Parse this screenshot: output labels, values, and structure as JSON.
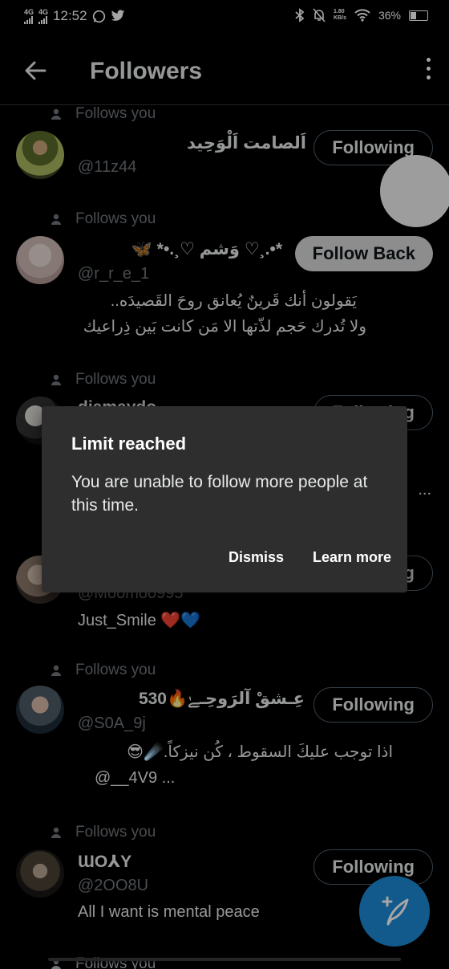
{
  "status_bar": {
    "net1": "4G",
    "net2": "4G",
    "time": "12:52",
    "speed_top": "1.80",
    "speed_bottom": "KB/s",
    "battery": "36%"
  },
  "header": {
    "title": "Followers"
  },
  "followers": [
    {
      "context": "Follows you",
      "name": "اَلصامت اَلْوَحِيد",
      "handle": "@11z44",
      "bio": [],
      "button": "Following"
    },
    {
      "context": "Follows you",
      "name": "🦋 *•.¸♡ وَشم ♡¸.•*",
      "handle": "@r_r_e_1",
      "bio": [
        "يَقولون أنك قَرينٌ يُعانق روحَ القَصيدَه..",
        "ولا تُدرك حَجم لذّتها الا مَن كانت بَين ذِراعيك"
      ],
      "button": "Follow Back"
    },
    {
      "context": "Follows you",
      "name": "djamaydo",
      "handle": "",
      "bio": [
        "..."
      ],
      "button": "Following"
    },
    {
      "context": "",
      "name": "",
      "handle": "@Moomoo995",
      "bio": [
        "Just_Smile ❤️💙"
      ],
      "button": "Following"
    },
    {
      "context": "Follows you",
      "name": "530🔥عِـشقْ آلرَوحِـﮯٰ",
      "handle": "@S0A_9j",
      "bio": [
        "اذا توجب عليكَ السقوط ، كُن نيزكاً.☄️😎",
        "@__4V9 ..."
      ],
      "button": "Following"
    },
    {
      "context": "Follows you",
      "name": "ƜO⅄Y",
      "handle": "@2OO8U",
      "bio": [
        "All I want is mental peace"
      ],
      "button": "Following"
    },
    {
      "context": "Follows you"
    }
  ],
  "dialog": {
    "title": "Limit reached",
    "message": "You are unable to follow more people at this time.",
    "dismiss": "Dismiss",
    "learn_more": "Learn more"
  },
  "colors": {
    "background": "#000000",
    "secondary_text": "#71767b",
    "dialog_bg": "#2e2e2e",
    "fab": "#1d8ad6"
  }
}
